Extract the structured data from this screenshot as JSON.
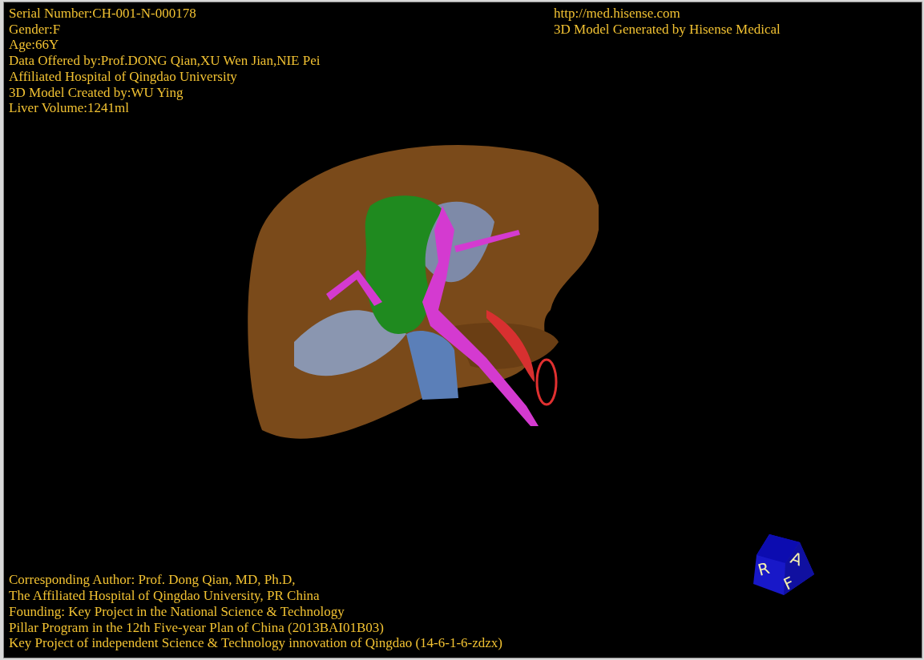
{
  "patient_info": [
    "Serial Number:CH-001-N-000178",
    "Gender:F",
    "Age:66Y",
    "Data Offered by:Prof.DONG Qian,XU Wen Jian,NIE Pei",
    "Affiliated Hospital of Qingdao University",
    "3D Model Created by:WU Ying",
    "Liver Volume:1241ml"
  ],
  "generator_info": [
    "http://med.hisense.com",
    "3D Model Generated by Hisense Medical"
  ],
  "credits": [
    "Corresponding Author: Prof. Dong Qian, MD, Ph.D,",
    "The Affiliated Hospital of Qingdao University, PR China",
    "Founding: Key Project in the National Science & Technology",
    "Pillar Program in the 12th Five-year Plan of China (2013BAI01B03)",
    "Key Project of independent Science & Technology innovation of Qingdao (14-6-1-6-zdzx)"
  ],
  "orientation_cube": {
    "faces": [
      "R",
      "A",
      "F"
    ]
  }
}
